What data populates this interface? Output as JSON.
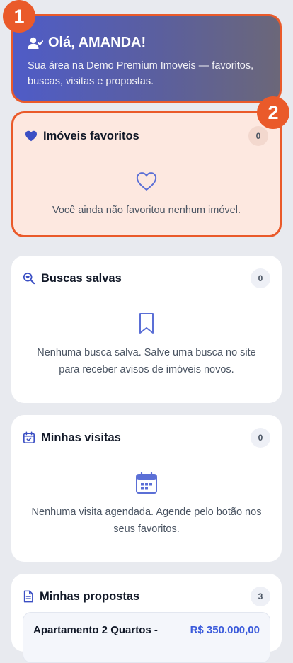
{
  "welcome": {
    "title": "Olá, AMANDA!",
    "subtitle": "Sua área na Demo Premium Imoveis — favoritos, buscas, visitas e propostas.",
    "marker": "1"
  },
  "favorites": {
    "marker": "2",
    "title": "Imóveis favoritos",
    "count": "0",
    "empty_text": "Você ainda não favoritou nenhum imóvel."
  },
  "saved_searches": {
    "title": "Buscas salvas",
    "count": "0",
    "empty_line1": "Nenhuma busca salva. Salve uma busca no site",
    "empty_line2": "para receber avisos de imóveis novos."
  },
  "visits": {
    "title": "Minhas visitas",
    "count": "0",
    "empty_line1": "Nenhuma visita agendada. Agende pelo botão nos",
    "empty_line2": "seus favoritos."
  },
  "proposals": {
    "title": "Minhas propostas",
    "count": "3",
    "items": [
      {
        "title": "Apartamento 2 Quartos -",
        "price": "R$ 350.000,00"
      }
    ]
  },
  "colors": {
    "accent": "#3b5bdb",
    "highlight": "#ea5a2a",
    "favorites_bg": "#fde8e0"
  }
}
